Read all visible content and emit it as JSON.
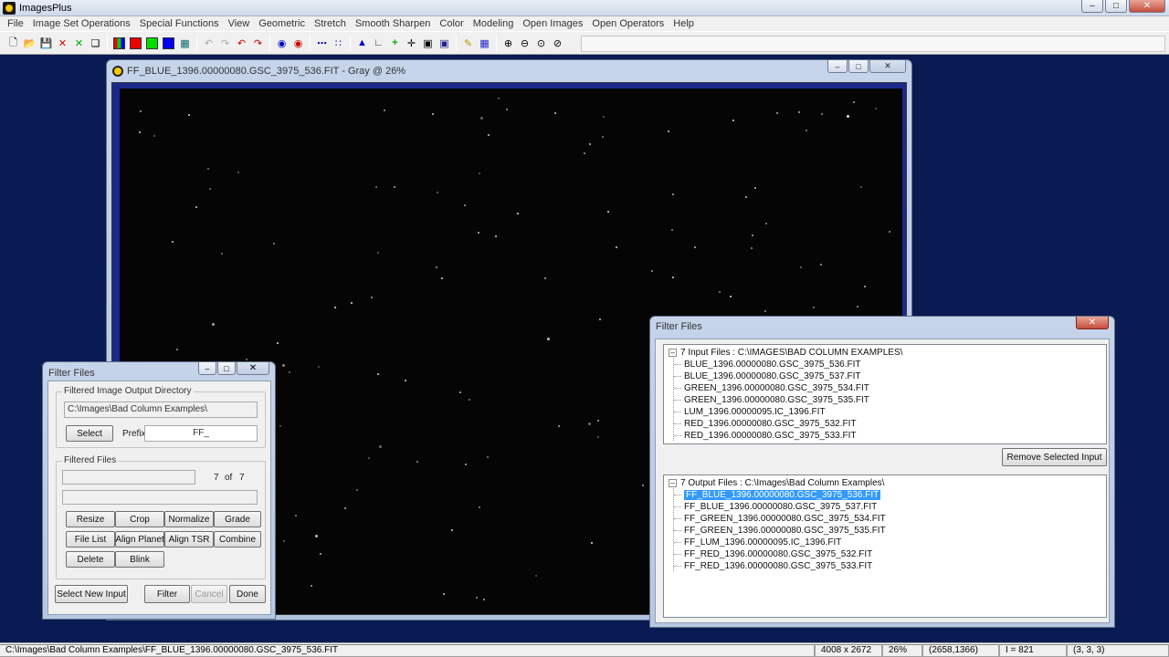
{
  "app": {
    "title": "ImagesPlus"
  },
  "menu": [
    "File",
    "Image Set Operations",
    "Special Functions",
    "View",
    "Geometric",
    "Stretch",
    "Smooth Sharpen",
    "Color",
    "Modeling",
    "Open Images",
    "Open Operators",
    "Help"
  ],
  "document": {
    "title": "FF_BLUE_1396.00000080.GSC_3975_536.FIT - Gray @ 26%"
  },
  "status": {
    "path": "C:\\Images\\Bad Column Examples\\FF_BLUE_1396.00000080.GSC_3975_536.FIT",
    "size": "4008 x 2672",
    "zoom": "26%",
    "coords": "(2658,1366)",
    "intensity": "I = 821",
    "rgb": "(3, 3, 3)"
  },
  "filter_small": {
    "title": "Filter Files",
    "output_group": "Filtered Image Output Directory",
    "output_dir": "C:\\Images\\Bad Column Examples\\",
    "select": "Select",
    "prefix_label": "Prefix:",
    "prefix_value": "FF_",
    "filtered_group": "Filtered Files",
    "count": "7",
    "of": "of",
    "total": "7",
    "buttons": [
      "Resize",
      "Crop",
      "Normalize",
      "Grade",
      "File List",
      "Align Planet",
      "Align TSR",
      "Combine",
      "Delete",
      "Blink"
    ],
    "select_new_input": "Select New Input",
    "filter": "Filter",
    "cancel": "Cancel",
    "done": "Done"
  },
  "filter_large": {
    "title": "Filter Files",
    "input_header": "7 Input Files : C:\\IMAGES\\BAD COLUMN EXAMPLES\\",
    "input_files": [
      "BLUE_1396.00000080.GSC_3975_536.FIT",
      "BLUE_1396.00000080.GSC_3975_537.FIT",
      "GREEN_1396.00000080.GSC_3975_534.FIT",
      "GREEN_1396.00000080.GSC_3975_535.FIT",
      "LUM_1396.00000095.IC_1396.FIT",
      "RED_1396.00000080.GSC_3975_532.FIT",
      "RED_1396.00000080.GSC_3975_533.FIT"
    ],
    "remove_selected": "Remove Selected Input",
    "output_header": "7 Output Files : C:\\Images\\Bad Column Examples\\",
    "output_files": [
      "FF_BLUE_1396.00000080.GSC_3975_536.FIT",
      "FF_BLUE_1396.00000080.GSC_3975_537.FIT",
      "FF_GREEN_1396.00000080.GSC_3975_534.FIT",
      "FF_GREEN_1396.00000080.GSC_3975_535.FIT",
      "FF_LUM_1396.00000095.IC_1396.FIT",
      "FF_RED_1396.00000080.GSC_3975_532.FIT",
      "FF_RED_1396.00000080.GSC_3975_533.FIT"
    ]
  }
}
